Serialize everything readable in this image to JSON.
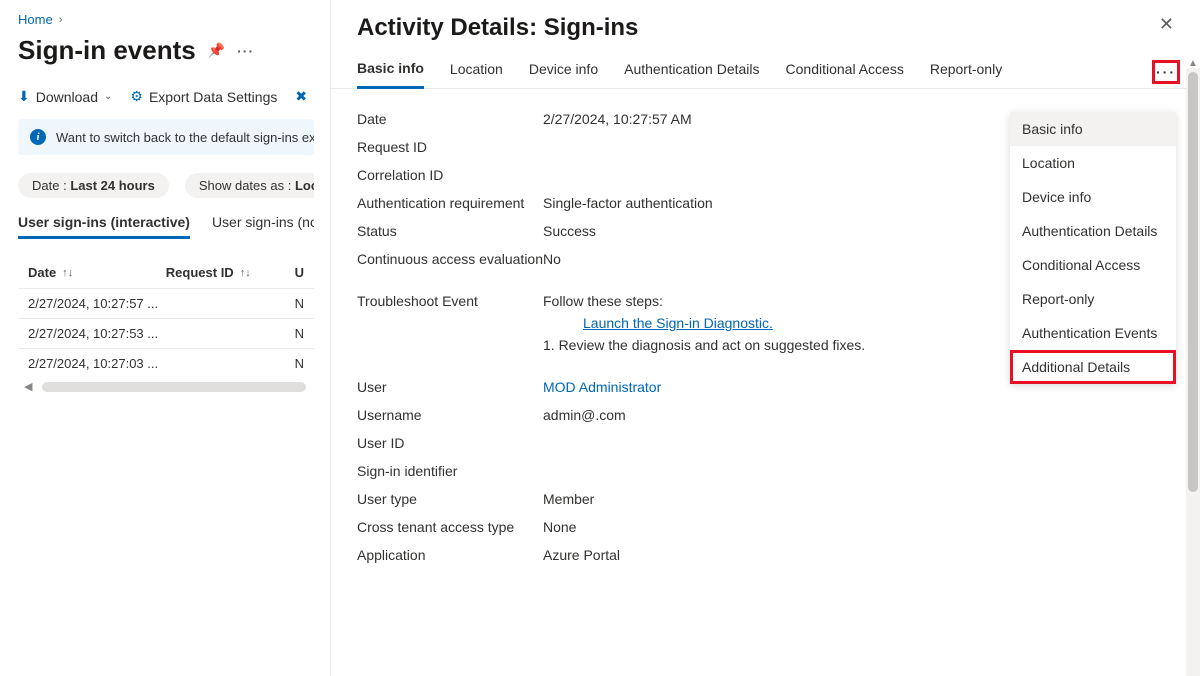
{
  "breadcrumb": {
    "home": "Home"
  },
  "page_title": "Sign-in events",
  "toolbar": {
    "download": "Download",
    "export": "Export Data Settings"
  },
  "banner": {
    "text": "Want to switch back to the default sign-ins experi"
  },
  "filters": {
    "date_label": "Date :",
    "date_value": "Last 24 hours",
    "show_as_label": "Show dates as :",
    "show_as_value": "Loca"
  },
  "sub_tabs": {
    "interactive": "User sign-ins (interactive)",
    "noninteractive": "User sign-ins (nor"
  },
  "table": {
    "headers": {
      "date": "Date",
      "request_id": "Request ID",
      "u": "U"
    },
    "rows": [
      {
        "date": "2/27/2024, 10:27:57 ...",
        "trail": "N"
      },
      {
        "date": "2/27/2024, 10:27:53 ...",
        "trail": "N"
      },
      {
        "date": "2/27/2024, 10:27:03 ...",
        "trail": "N"
      }
    ]
  },
  "detail": {
    "title": "Activity Details: Sign-ins",
    "tabs": [
      "Basic info",
      "Location",
      "Device info",
      "Authentication Details",
      "Conditional Access",
      "Report-only"
    ],
    "kv": {
      "date_k": "Date",
      "date_v": "2/27/2024, 10:27:57 AM",
      "req_k": "Request ID",
      "req_v": "",
      "corr_k": "Correlation ID",
      "corr_v": "",
      "authr_k": "Authentication requirement",
      "authr_v": "Single-factor authentication",
      "status_k": "Status",
      "status_v": "Success",
      "cae_k": "Continuous access evaluation",
      "cae_v": "No",
      "trouble_k": "Troubleshoot Event",
      "steps_title": "Follow these steps:",
      "steps_link": "Launch the Sign-in Diagnostic.",
      "steps_item": "1. Review the diagnosis and act on suggested fixes.",
      "user_k": "User",
      "user_v": "MOD Administrator",
      "username_k": "Username",
      "username_v": "admin@.com",
      "userid_k": "User ID",
      "userid_v": "",
      "signinid_k": "Sign-in identifier",
      "signinid_v": "",
      "usertype_k": "User type",
      "usertype_v": "Member",
      "crosstenant_k": "Cross tenant access type",
      "crosstenant_v": "None",
      "app_k": "Application",
      "app_v": "Azure Portal"
    },
    "dropdown": [
      "Basic info",
      "Location",
      "Device info",
      "Authentication Details",
      "Conditional Access",
      "Report-only",
      "Authentication Events",
      "Additional Details"
    ]
  }
}
